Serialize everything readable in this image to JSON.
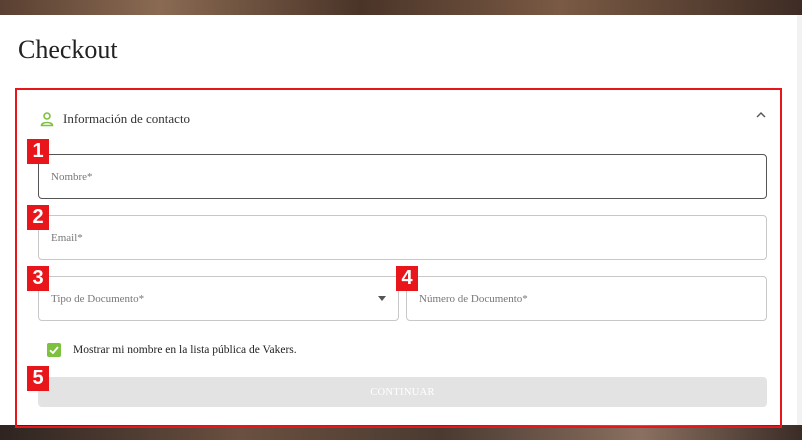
{
  "page": {
    "title": "Checkout"
  },
  "contact_section": {
    "heading": "Información de contacto",
    "icon": "user-icon",
    "accent_color": "#7dc13f",
    "highlight_color": "#e8151b"
  },
  "fields": {
    "nombre_label": "Nombre*",
    "email_label": "Email*",
    "tipo_documento_label": "Tipo de Documento*",
    "numero_documento_label": "Número de Documento*"
  },
  "checkbox": {
    "label": "Mostrar mi nombre en la lista pública de Vakers.",
    "checked": true
  },
  "continue_button": {
    "label": "CONTINUAR",
    "disabled": true
  },
  "badges": [
    "1",
    "2",
    "3",
    "4",
    "5"
  ]
}
